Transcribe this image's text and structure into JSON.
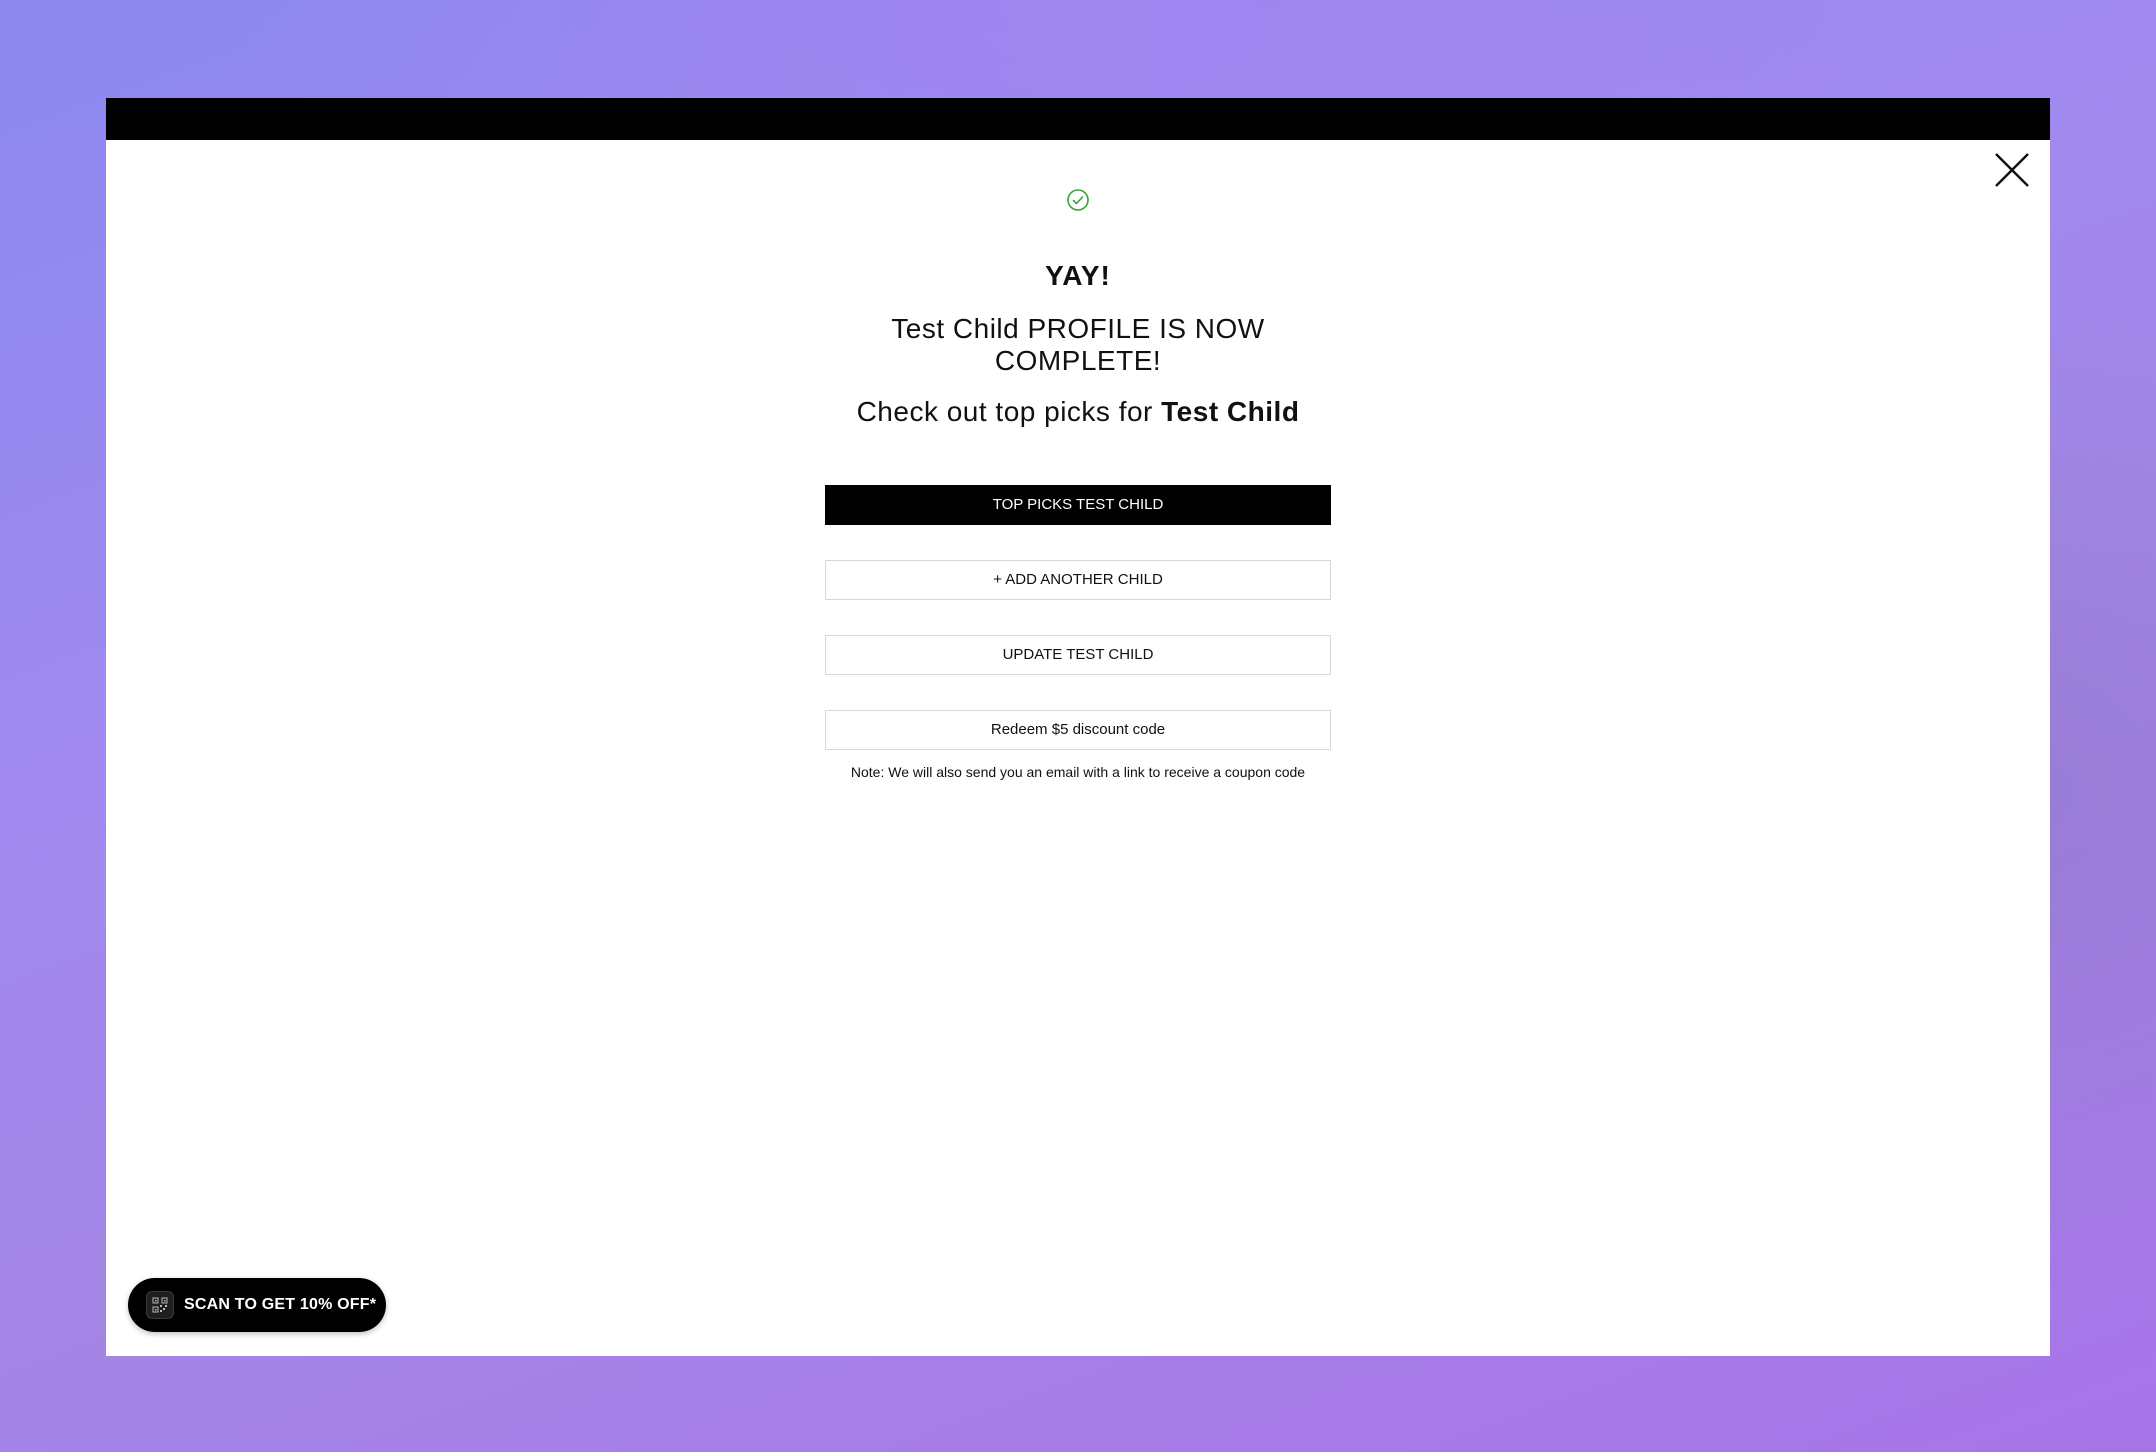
{
  "modal": {
    "close_label": "Close",
    "heading": "YAY!",
    "complete_line": "Test Child PROFILE IS NOW COMPLETE!",
    "picks_prefix": "Check out top picks for ",
    "picks_name": "Test Child",
    "buttons": {
      "top_picks": "TOP PICKS TEST CHILD",
      "add_child": "+ ADD ANOTHER CHILD",
      "update_child": "UPDATE TEST CHILD",
      "redeem": "Redeem $5 discount code"
    },
    "note": "Note: We will also send you an email with a link to receive a coupon code"
  },
  "promo": {
    "label": "SCAN TO GET 10% OFF*",
    "icon": "qr-code-icon"
  },
  "colors": {
    "accent": "#000000",
    "success": "#3aa335"
  }
}
